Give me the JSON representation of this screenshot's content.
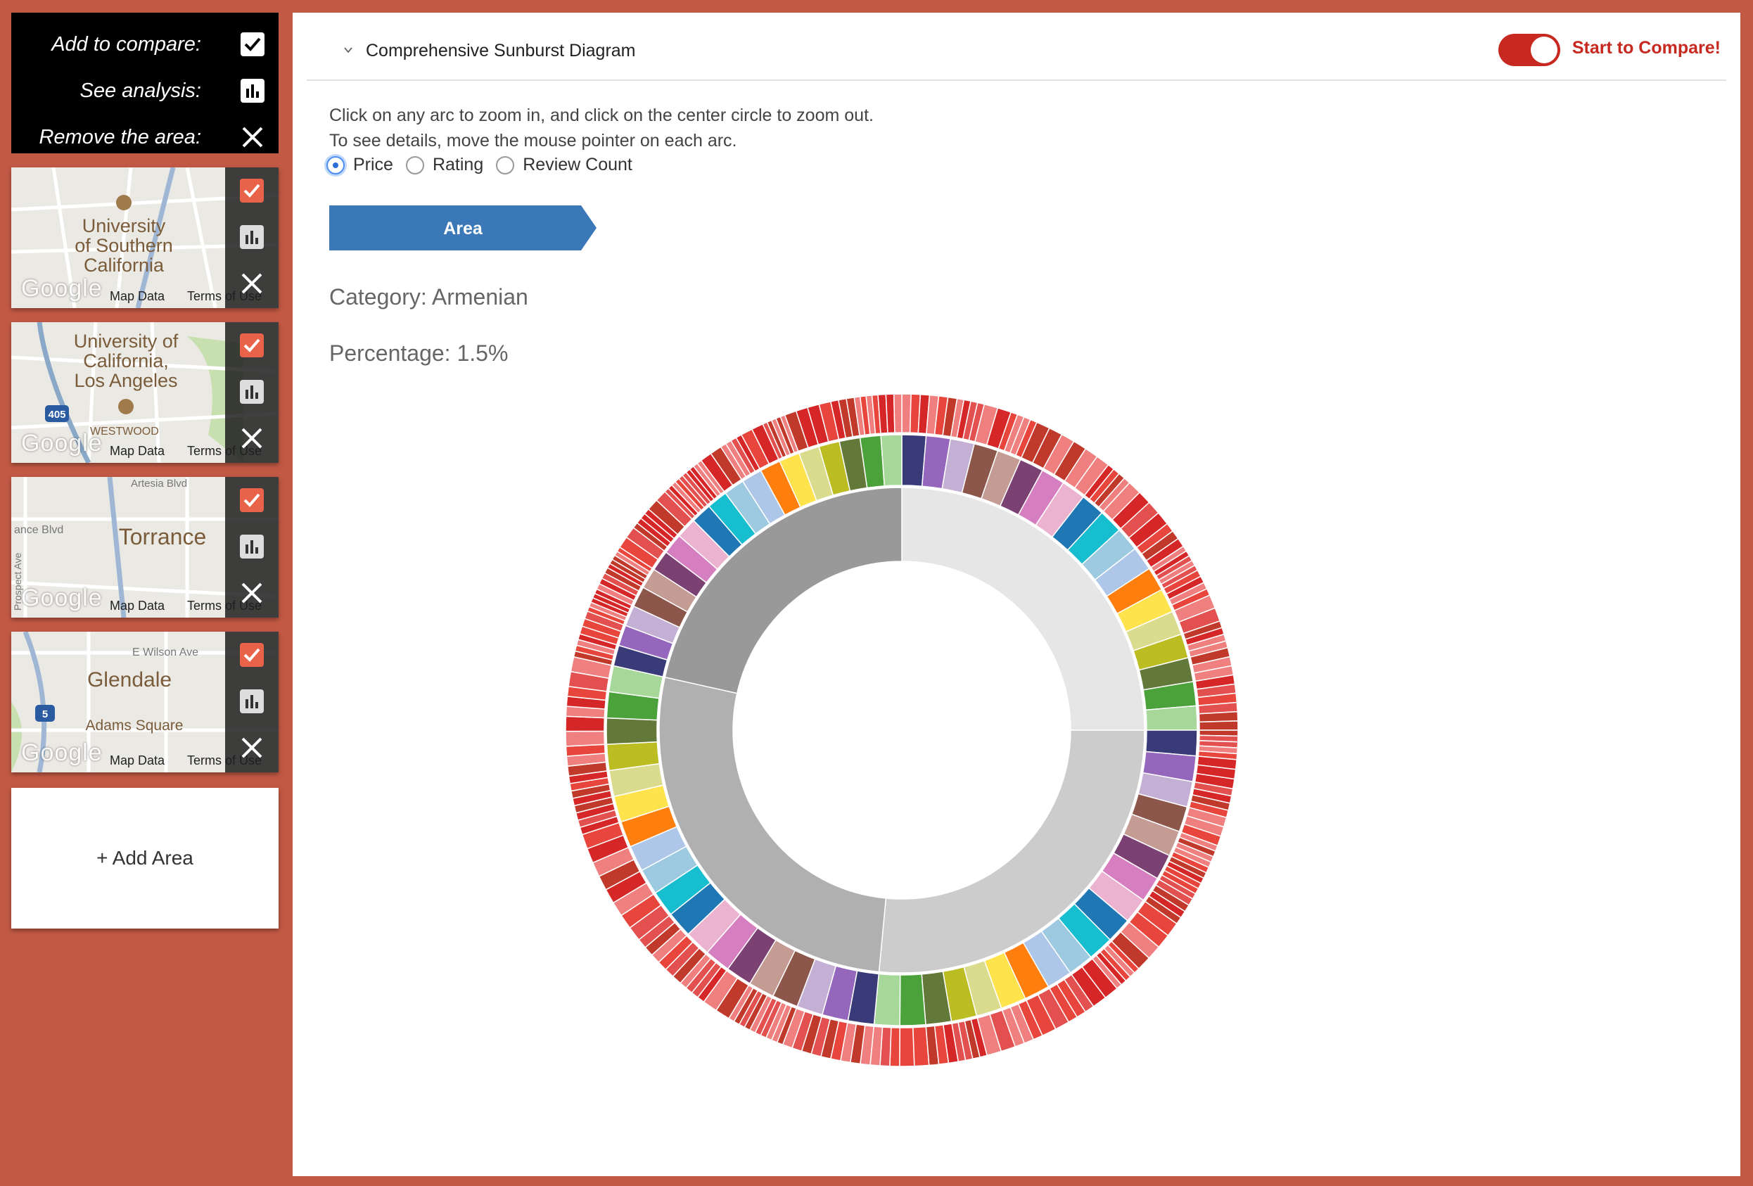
{
  "legend": {
    "compare_label": "Add to compare:",
    "analysis_label": "See analysis:",
    "remove_label": "Remove the area:"
  },
  "areas": [
    {
      "name": "University of Southern California",
      "label_lines": [
        "University",
        "of Southern",
        "California"
      ],
      "selected": true
    },
    {
      "name": "University of California, Los Angeles",
      "label_lines": [
        "University of",
        "California,",
        "Los Angeles"
      ],
      "extra": [
        "WESTWOOD",
        "405"
      ],
      "selected": true
    },
    {
      "name": "Torrance",
      "label_lines": [
        "Torrance"
      ],
      "extra": [
        "Artesia Blvd",
        "ance Blvd",
        "Prospect Ave"
      ],
      "selected": true
    },
    {
      "name": "Glendale",
      "label_lines": [
        "Glendale"
      ],
      "extra": [
        "E Wilson Ave",
        "Adams Square",
        "5"
      ],
      "selected": true
    }
  ],
  "map_attribution": {
    "logo": "Google",
    "map_data": "Map Data",
    "terms": "Terms of Use"
  },
  "add_area_label": "+ Add Area",
  "panel": {
    "title": "Comprehensive Sunburst Diagram",
    "compare_label": "Start to Compare!",
    "compare_on": true,
    "instruction_1": "Click on any arc to zoom in, and click on the center circle to zoom out.",
    "instruction_2": "To see details, move the mouse pointer on each arc.",
    "metrics": [
      {
        "label": "Price",
        "selected": true
      },
      {
        "label": "Rating",
        "selected": false
      },
      {
        "label": "Review Count",
        "selected": false
      }
    ],
    "breadcrumb": "Area",
    "category_text": "Category: Armenian",
    "percentage_text": "Percentage: 1.5%"
  },
  "colors": {
    "background": "#c25944",
    "accent": "#c7281f",
    "breadcrumb": "#3a78b8",
    "checkbox": "#e8634a"
  },
  "chart_data": {
    "type": "sunburst",
    "levels": [
      {
        "level": 1,
        "segments": [
          {
            "share": 0.25,
            "color": "#e6e6e6"
          },
          {
            "share": 0.265,
            "color": "#cccccc"
          },
          {
            "share": 0.27,
            "color": "#b0b0b0"
          },
          {
            "share": 0.215,
            "color": "#999999"
          }
        ]
      },
      {
        "level": 2,
        "palette": [
          "#393b79",
          "#9467bd",
          "#c5b0d5",
          "#8c564b",
          "#c49c94",
          "#7b4173",
          "#d67fc0",
          "#ecb3d0",
          "#1f77b4",
          "#17becf",
          "#9ecae1",
          "#aec7e8",
          "#ff7f0e",
          "#ffe34d",
          "#dbdb8d",
          "#bcbd22",
          "#637939",
          "#4ca23a",
          "#a6d89a"
        ]
      },
      {
        "level": 3,
        "palette": [
          "#e8453c",
          "#d62728",
          "#f08080",
          "#e35050",
          "#c0392b"
        ]
      }
    ]
  }
}
